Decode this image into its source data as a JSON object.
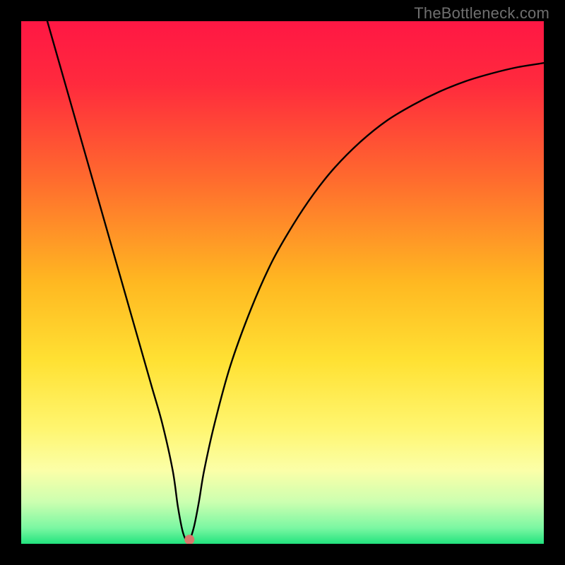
{
  "watermark": "TheBottleneck.com",
  "chart_data": {
    "type": "line",
    "title": "",
    "xlabel": "",
    "ylabel": "",
    "xlim": [
      0,
      100
    ],
    "ylim": [
      0,
      100
    ],
    "grid": false,
    "legend": false,
    "background": {
      "type": "vertical-gradient",
      "stops": [
        {
          "pos": 0.0,
          "color": "#ff1744"
        },
        {
          "pos": 0.12,
          "color": "#ff2a3d"
        },
        {
          "pos": 0.3,
          "color": "#ff6a2e"
        },
        {
          "pos": 0.5,
          "color": "#ffb821"
        },
        {
          "pos": 0.65,
          "color": "#ffe133"
        },
        {
          "pos": 0.78,
          "color": "#fff670"
        },
        {
          "pos": 0.86,
          "color": "#fbffa8"
        },
        {
          "pos": 0.92,
          "color": "#ccffb0"
        },
        {
          "pos": 0.97,
          "color": "#7af7a2"
        },
        {
          "pos": 1.0,
          "color": "#22e37e"
        }
      ]
    },
    "series": [
      {
        "name": "bottleneck-curve",
        "color": "#000000",
        "x": [
          5,
          7,
          9,
          11,
          13,
          15,
          17,
          19,
          21,
          23,
          25,
          27,
          29,
          30,
          31,
          32,
          33,
          34,
          35,
          37,
          40,
          44,
          48,
          52,
          56,
          60,
          65,
          70,
          75,
          80,
          85,
          90,
          95,
          100
        ],
        "y": [
          100,
          93,
          86,
          79,
          72,
          65,
          58,
          51,
          44,
          37,
          30,
          23,
          14,
          7,
          2,
          0.5,
          3,
          8,
          14,
          23,
          34,
          45,
          54,
          61,
          67,
          72,
          77,
          81,
          84,
          86.5,
          88.5,
          90,
          91.2,
          92
        ]
      }
    ],
    "marker": {
      "name": "optimal-point",
      "x": 32.2,
      "y": 0.8,
      "color": "#d8776c",
      "radius_px": 7
    }
  }
}
